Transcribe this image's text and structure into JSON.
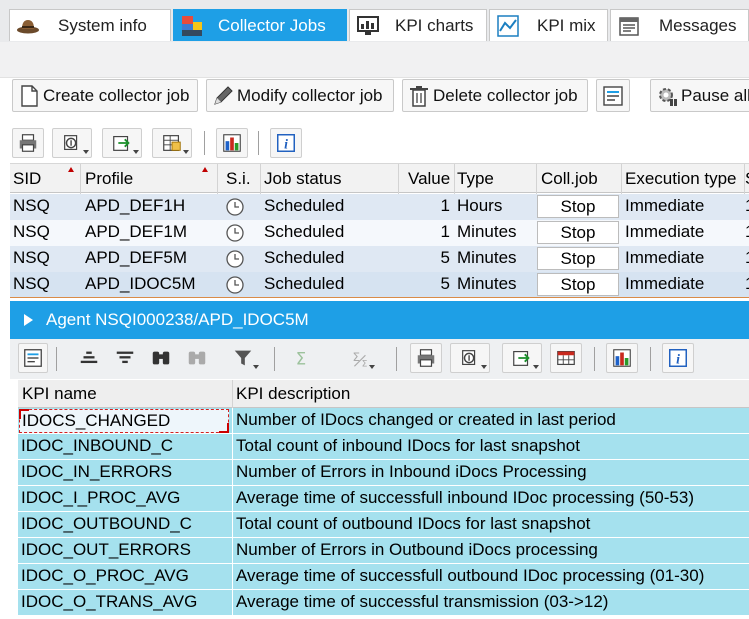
{
  "tabs": [
    {
      "label": "System info",
      "icon": "hat-icon",
      "active": false
    },
    {
      "label": "Collector Jobs",
      "icon": "collector-jobs-icon",
      "active": true
    },
    {
      "label": "KPI charts",
      "icon": "monitor-chart-icon",
      "active": false
    },
    {
      "label": "KPI mix",
      "icon": "line-chart-icon",
      "active": false
    },
    {
      "label": "Messages",
      "icon": "messages-icon",
      "active": false
    }
  ],
  "toolbar": {
    "create_label": "Create collector job",
    "modify_label": "Modify collector job",
    "delete_label": "Delete collector job",
    "pause_label": "Pause all"
  },
  "jobs_grid": {
    "headers": {
      "sid": "SID",
      "profile": "Profile",
      "si": "S.i.",
      "job_status": "Job status",
      "value": "Value",
      "type": "Type",
      "coll_job": "Coll.job",
      "execution_type": "Execution type",
      "cut": "S"
    },
    "rows": [
      {
        "sid": "NSQ",
        "profile": "APD_DEF1H",
        "job_status": "Scheduled",
        "value": "1",
        "type": "Hours",
        "coll_job": "Stop",
        "execution_type": "Immediate",
        "cut": "1"
      },
      {
        "sid": "NSQ",
        "profile": "APD_DEF1M",
        "job_status": "Scheduled",
        "value": "1",
        "type": "Minutes",
        "coll_job": "Stop",
        "execution_type": "Immediate",
        "cut": "1"
      },
      {
        "sid": "NSQ",
        "profile": "APD_DEF5M",
        "job_status": "Scheduled",
        "value": "5",
        "type": "Minutes",
        "coll_job": "Stop",
        "execution_type": "Immediate",
        "cut": "1"
      },
      {
        "sid": "NSQ",
        "profile": "APD_IDOC5M",
        "job_status": "Scheduled",
        "value": "5",
        "type": "Minutes",
        "coll_job": "Stop",
        "execution_type": "Immediate",
        "cut": "1"
      }
    ]
  },
  "agent_panel": {
    "title": "Agent NSQI000238/APD_IDOC5M",
    "headers": {
      "kpi_name": "KPI name",
      "kpi_description": "KPI description"
    },
    "rows": [
      {
        "name": "IDOCS_CHANGED",
        "description": "Number of IDocs changed or created in last period"
      },
      {
        "name": "IDOC_INBOUND_C",
        "description": "Total count of inbound IDocs for last snapshot"
      },
      {
        "name": "IDOC_IN_ERRORS",
        "description": "Number of Errors in Inbound iDocs Processing"
      },
      {
        "name": "IDOC_I_PROC_AVG",
        "description": "Average time of successfull inbound IDoc processing (50-53)"
      },
      {
        "name": "IDOC_OUTBOUND_C",
        "description": "Total count of outbound IDocs for last snapshot"
      },
      {
        "name": "IDOC_OUT_ERRORS",
        "description": "Number of Errors in Outbound iDocs processing"
      },
      {
        "name": "IDOC_O_PROC_AVG",
        "description": "Average time of successfull outbound IDoc processing (01-30)"
      },
      {
        "name": "IDOC_O_TRANS_AVG",
        "description": "Average time of successful transmission (03->12)"
      }
    ]
  },
  "colors": {
    "accent": "#1e9fe6",
    "kpi_row": "#a5e1ee",
    "grid_row_alt": "#dfe8f3",
    "sort_marker": "#c00000"
  }
}
